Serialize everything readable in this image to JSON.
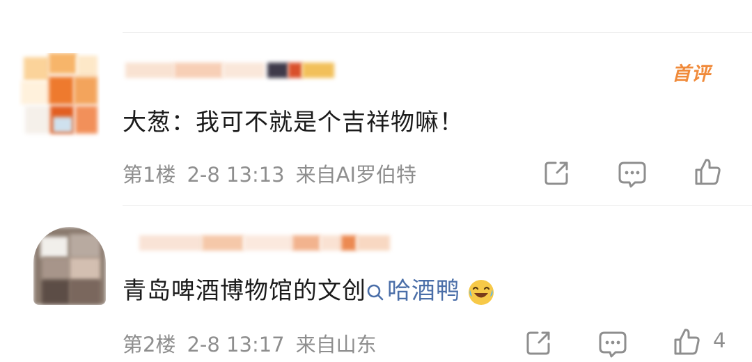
{
  "comments": [
    {
      "text": "大葱：我可不就是个吉祥物嘛！",
      "floor": "第1楼",
      "time": "2-8 13:13",
      "source": "来自AI罗伯特",
      "badge": "首评",
      "like_count": ""
    },
    {
      "text": "青岛啤酒博物馆的文创",
      "topic": "哈酒鸭",
      "floor": "第2楼",
      "time": "2-8 13:17",
      "source": "来自山东",
      "like_count": "4"
    }
  ],
  "colors": {
    "badge": "#f08a3a",
    "topic_link": "#4a6ea8",
    "meta": "#8e8e8e",
    "icon": "#8e8e8e"
  },
  "icons": [
    "share-icon",
    "comment-icon",
    "like-icon",
    "search-icon",
    "laughing-emoji-icon"
  ]
}
